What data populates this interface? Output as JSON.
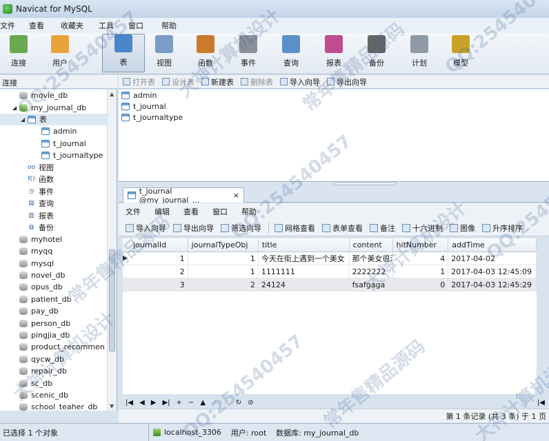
{
  "window": {
    "title": "Navicat for MySQL"
  },
  "menubar": [
    "文件",
    "查看",
    "收藏夹",
    "工具",
    "窗口",
    "帮助"
  ],
  "toolbar": [
    {
      "label": "连接",
      "icon": "connection-icon",
      "color": "#6aa84f"
    },
    {
      "label": "用户",
      "icon": "user-icon",
      "color": "#e8a23a"
    },
    {
      "label": "表",
      "icon": "table-icon",
      "color": "#4a86c8",
      "active": true
    },
    {
      "label": "视图",
      "icon": "view-icon",
      "color": "#7a9cc6"
    },
    {
      "label": "函数",
      "icon": "function-icon",
      "color": "#c97a2b"
    },
    {
      "label": "事件",
      "icon": "event-icon",
      "color": "#8a8f99"
    },
    {
      "label": "查询",
      "icon": "query-icon",
      "color": "#5b8fc9"
    },
    {
      "label": "报表",
      "icon": "report-icon",
      "color": "#c04c8e"
    },
    {
      "label": "备份",
      "icon": "backup-icon",
      "color": "#666666"
    },
    {
      "label": "计划",
      "icon": "schedule-icon",
      "color": "#8f9aa7"
    },
    {
      "label": "模型",
      "icon": "model-icon",
      "color": "#c9a227"
    }
  ],
  "sidebar": {
    "header": "连接",
    "rows": [
      {
        "label": "movie_db",
        "level": 1,
        "kind": "db"
      },
      {
        "label": "my_journal_db",
        "level": 1,
        "kind": "db-open",
        "expanded": true
      },
      {
        "label": "表",
        "level": 2,
        "kind": "tbl",
        "expanded": true,
        "selected": true
      },
      {
        "label": "admin",
        "level": 3,
        "kind": "tbl"
      },
      {
        "label": "t_journal",
        "level": 3,
        "kind": "tbl"
      },
      {
        "label": "t_journaltype",
        "level": 3,
        "kind": "tbl"
      },
      {
        "label": "视图",
        "level": 2,
        "kind": "glyph",
        "glyph": "oo"
      },
      {
        "label": "函数",
        "level": 2,
        "kind": "glyph",
        "glyph": "f()"
      },
      {
        "label": "事件",
        "level": 2,
        "kind": "glyph",
        "glyph": "◷"
      },
      {
        "label": "查询",
        "level": 2,
        "kind": "glyph",
        "glyph": "▤"
      },
      {
        "label": "报表",
        "level": 2,
        "kind": "glyph",
        "glyph": "▥"
      },
      {
        "label": "备份",
        "level": 2,
        "kind": "glyph",
        "glyph": "◍"
      },
      {
        "label": "myhotel",
        "level": 1,
        "kind": "db"
      },
      {
        "label": "myqq",
        "level": 1,
        "kind": "db"
      },
      {
        "label": "mysql",
        "level": 1,
        "kind": "db"
      },
      {
        "label": "novel_db",
        "level": 1,
        "kind": "db"
      },
      {
        "label": "opus_db",
        "level": 1,
        "kind": "db"
      },
      {
        "label": "patient_db",
        "level": 1,
        "kind": "db"
      },
      {
        "label": "pay_db",
        "level": 1,
        "kind": "db"
      },
      {
        "label": "person_db",
        "level": 1,
        "kind": "db"
      },
      {
        "label": "pingjia_db",
        "level": 1,
        "kind": "db"
      },
      {
        "label": "product_recommen",
        "level": 1,
        "kind": "db"
      },
      {
        "label": "qycw_db",
        "level": 1,
        "kind": "db"
      },
      {
        "label": "repair_db",
        "level": 1,
        "kind": "db"
      },
      {
        "label": "sc_db",
        "level": 1,
        "kind": "db"
      },
      {
        "label": "scenic_db",
        "level": 1,
        "kind": "db"
      },
      {
        "label": "school_teaher_db",
        "level": 1,
        "kind": "db"
      }
    ]
  },
  "object_toolbar": [
    {
      "label": "打开表",
      "disabled": true
    },
    {
      "label": "设计表",
      "disabled": true
    },
    {
      "label": "新建表",
      "disabled": false
    },
    {
      "label": "删除表",
      "disabled": true
    },
    {
      "label": "导入向导",
      "disabled": false
    },
    {
      "label": "导出向导",
      "disabled": false
    }
  ],
  "objects": [
    "admin",
    "t_journal",
    "t_journaltype"
  ],
  "tab": {
    "label": "t_journal @my_journal_...",
    "close": "×"
  },
  "tab_menu": [
    "文件",
    "编辑",
    "查看",
    "窗口",
    "帮助"
  ],
  "grid_toolbar": [
    "导入向导",
    "导出向导",
    "筛选向导",
    "网格查看",
    "表单查看",
    "备注",
    "十六进制",
    "图像",
    "升序排序"
  ],
  "grid": {
    "columns": [
      "journalId",
      "journalTypeObj",
      "title",
      "content",
      "hitNumber",
      "addTime"
    ],
    "rows": [
      [
        "1",
        "1",
        "今天在街上遇到一个美女",
        "那个美女很漂",
        "4",
        "2017-04-02"
      ],
      [
        "2",
        "1",
        "1111111",
        "2222222",
        "1",
        "2017-04-03 12:45:09"
      ],
      [
        "3",
        "2",
        "24124",
        "fsafgaga",
        "0",
        "2017-04-03 12:45:29"
      ]
    ]
  },
  "nav_buttons": [
    {
      "glyph": "|◀",
      "disabled": false
    },
    {
      "glyph": "◀",
      "disabled": false
    },
    {
      "glyph": "▶",
      "disabled": false
    },
    {
      "glyph": "▶|",
      "disabled": false
    },
    {
      "glyph": "+",
      "disabled": false
    },
    {
      "glyph": "−",
      "disabled": false
    },
    {
      "glyph": "▲",
      "disabled": false
    },
    {
      "glyph": "✓",
      "disabled": true
    },
    {
      "glyph": "✕",
      "disabled": true
    },
    {
      "glyph": "↻",
      "disabled": false
    },
    {
      "glyph": "⊘",
      "disabled": false
    }
  ],
  "grid_status": "第 1 条记录 (共 3 条) 于 1 页",
  "statusbar": {
    "selection": "已选择 1 个对象",
    "host": "localhost_3306",
    "user": "用户: root",
    "database": "数据库: my_journal_db"
  },
  "watermarks": [
    "QQ:254540457",
    "大神计算机设计",
    "常年售精品源码"
  ]
}
